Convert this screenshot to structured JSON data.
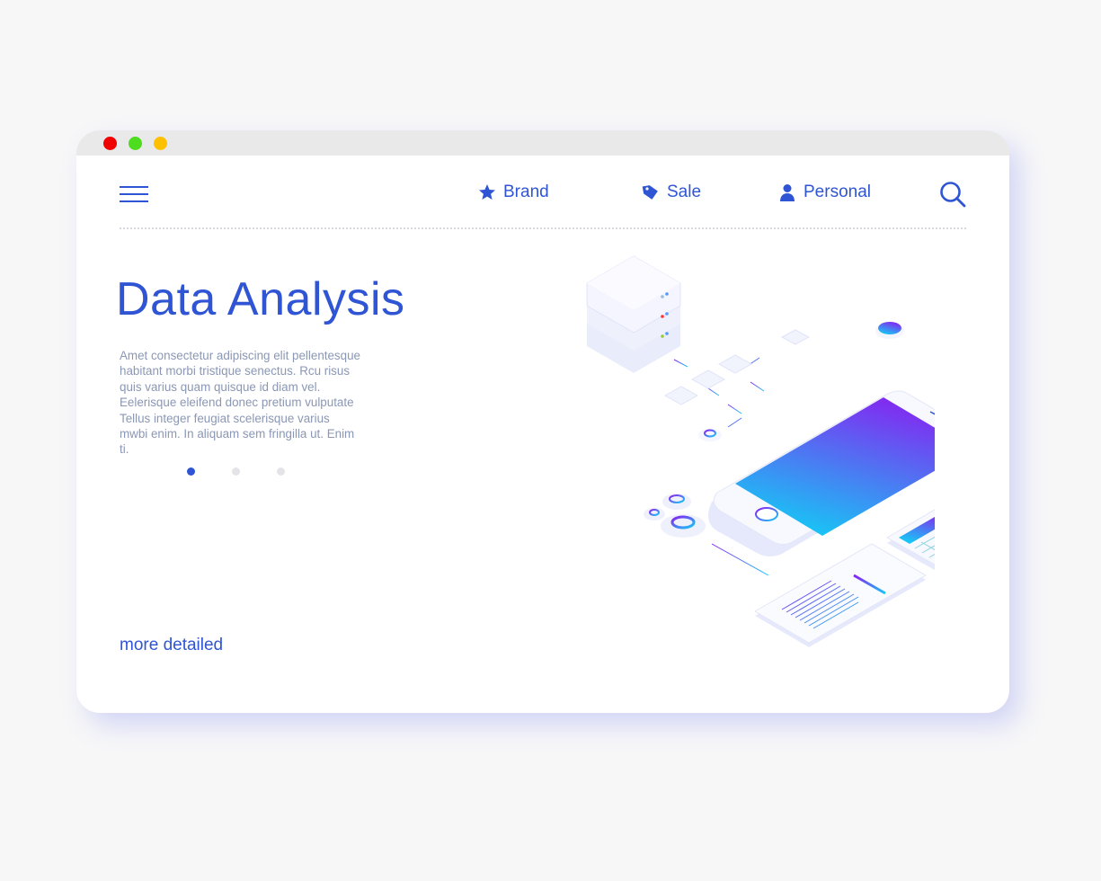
{
  "window_controls": {
    "close_color": "#f10000",
    "minimize_color": "#4ddc1e",
    "maximize_color": "#ffc000"
  },
  "nav": {
    "menu_icon": "hamburger-icon",
    "items": [
      {
        "label": "Brand",
        "icon": "star-icon"
      },
      {
        "label": "Sale",
        "icon": "tag-icon"
      },
      {
        "label": "Personal",
        "icon": "user-icon"
      }
    ],
    "search_icon": "search-icon"
  },
  "hero": {
    "title": "Data Analysis",
    "body": "Amet consectetur adipiscing elit pellentesque habitant morbi tristique senectus. Rcu risus quis varius quam quisque id diam vel. Eelerisque eleifend donec pretium vulputate Tellus integer feugiat scelerisque varius mwbi enim. In aliquam sem fringilla ut. Enim ti.",
    "pagination": {
      "count": 3,
      "active": 1
    },
    "link": "more detailed"
  },
  "colors": {
    "accent": "#2f55d4",
    "text_muted": "#8a97b5",
    "gradient_start": "#8a1ef0",
    "gradient_end": "#16c8f5"
  }
}
